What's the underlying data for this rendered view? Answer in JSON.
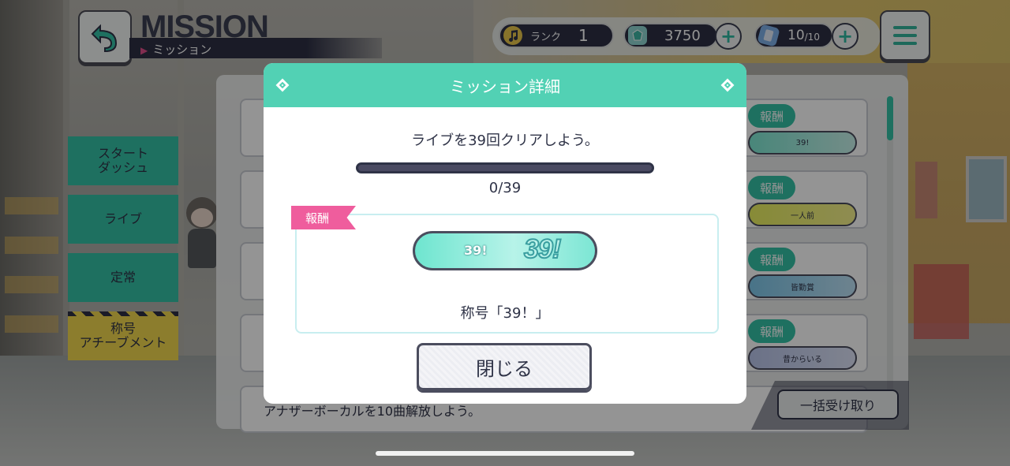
{
  "header": {
    "title": "MISSION",
    "subtitle": "ミッション",
    "rank_label": "ランク",
    "rank_value": "1",
    "crystals": "3750",
    "stamina": "10",
    "stamina_max": "/10"
  },
  "tabs": [
    {
      "label": "スタート\nダッシュ"
    },
    {
      "label": "ライブ"
    },
    {
      "label": "定常"
    },
    {
      "label": "称号\nアチーブメント"
    }
  ],
  "mission_list": {
    "reward_label": "報酬",
    "rewards": [
      {
        "item_label": "39!"
      },
      {
        "item_label": "一人前"
      },
      {
        "item_label": "皆勤賞"
      },
      {
        "item_label": "昔からいる"
      }
    ],
    "bottom_row_text": "アナザーボーカルを10曲解放しよう。",
    "claim_all_label": "一括受け取り"
  },
  "modal": {
    "title": "ミッション詳細",
    "description": "ライブを39回クリアしよう。",
    "progress_text": "0/39",
    "progress_fraction": 0,
    "reward_flag": "報酬",
    "badge_small": "39!",
    "badge_big": "39!",
    "reward_name": "称号「39！」",
    "close_label": "閉じる"
  },
  "colors": {
    "accent_teal": "#52d1b4",
    "reward_pink": "#ef5d9d",
    "navy": "#2f3347"
  }
}
